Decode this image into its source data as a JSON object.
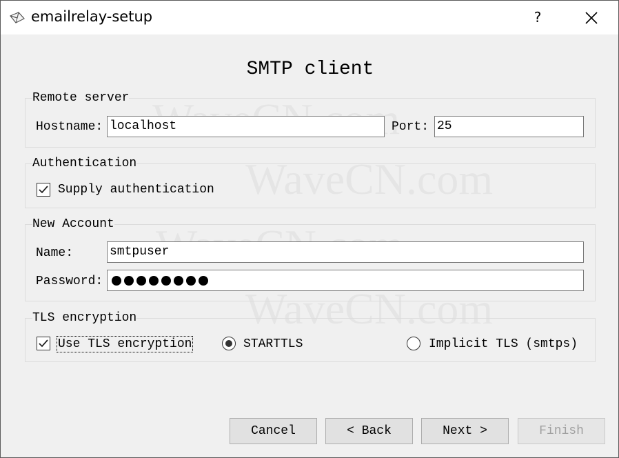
{
  "window": {
    "title": "emailrelay-setup",
    "help_label": "?"
  },
  "page": {
    "title": "SMTP client"
  },
  "remote_server": {
    "title": "Remote server",
    "hostname_label": "Hostname:",
    "hostname_value": "localhost",
    "port_label": "Port:",
    "port_value": "25"
  },
  "authentication": {
    "title": "Authentication",
    "supply_label": "Supply authentication",
    "supply_checked": true
  },
  "new_account": {
    "title": "New Account",
    "name_label": "Name:",
    "name_value": "smtpuser",
    "password_label": "Password:",
    "password_mask_count": 8
  },
  "tls": {
    "title": "TLS encryption",
    "use_tls_label": "Use TLS encryption",
    "use_tls_checked": true,
    "starttls_label": "STARTTLS",
    "starttls_selected": true,
    "implicit_label": "Implicit TLS (smtps)",
    "implicit_selected": false
  },
  "buttons": {
    "cancel": "Cancel",
    "back": "< Back",
    "next": "Next >",
    "finish": "Finish",
    "finish_enabled": false
  },
  "watermark": "WaveCN.com",
  "colors": {
    "titlebar": "#ffffff",
    "dialog": "#f0f0f0",
    "disabled_text": "#a0a0a0"
  }
}
